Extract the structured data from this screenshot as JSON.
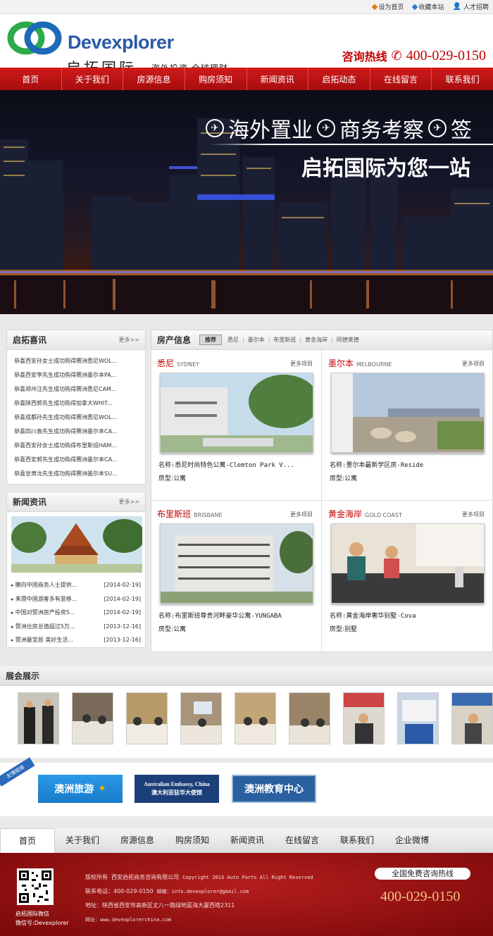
{
  "topbar": {
    "set_home": "设为首页",
    "bookmark": "收藏本站",
    "jobs": "人才招聘"
  },
  "header": {
    "brand_en": "Devexplorer",
    "brand_cn": "启拓国际",
    "tagline": "海外投资 全球理财",
    "hotline_label": "咨询热线",
    "hotline_number": "400-029-0150"
  },
  "nav": [
    "首页",
    "关于我们",
    "房源信息",
    "购房须知",
    "新闻资讯",
    "启拓动态",
    "在线留言",
    "联系我们"
  ],
  "banner": {
    "line1": [
      "海外置业",
      "商务考察",
      "签"
    ],
    "line2": "启拓国际为您一站"
  },
  "qituo_news": {
    "title": "启拓喜讯",
    "more": "更多>>",
    "items": [
      "恭喜西安孙女士成功购得赛洲悉尼WOL...",
      "恭喜西安李先生成功购得赛洲墨尔本PA...",
      "恭喜郑州汪先生成功购得赛洲悉尼CAM...",
      "恭喜陕西郭先生成功购得加拿大WHIT...",
      "恭喜成都孙先生成功购得赛洲悉尼WOL...",
      "恭喜四川袁先生成功购得赛洲墨尔本CA...",
      "恭喜西安孙女士成功购得布里斯班HAM...",
      "恭喜西安郭先生成功购得赛洲墨尔本CA...",
      "恭喜甘肃沈先生成功购得赛洲墨尔本SU..."
    ]
  },
  "news": {
    "title": "新闻资讯",
    "more": "更多>>",
    "items": [
      {
        "text": "瞭向中国商务人士提供...",
        "date": "[2014-02-19]"
      },
      {
        "text": "来瓒中国游客多有意移...",
        "date": "[2014-02-19]"
      },
      {
        "text": "中国对赞洲房产投资5...",
        "date": "[2014-02-19]"
      },
      {
        "text": "赞洲住房总值超过5万...",
        "date": "[2013-12-16]"
      },
      {
        "text": "赞洲最宜居 美好生活...",
        "date": "[2013-12-16]"
      }
    ]
  },
  "property": {
    "title": "房产信息",
    "recommend": "推荐",
    "tabs": [
      "悉尼",
      "墨尔本",
      "布里斯班",
      "黄金海岸",
      "阿德莱德"
    ],
    "items": [
      {
        "city": "悉尼",
        "city_en": "SYDNEY",
        "more": "更多项目",
        "name": "名称:悉尼时尚特色公寓-Clemton Park V...",
        "type": "房型:公寓"
      },
      {
        "city": "墨尔本",
        "city_en": "MELBOURNE",
        "more": "更多项目",
        "name": "名称:墨尔本最新学区房-Reside",
        "type": "房型:公寓"
      },
      {
        "city": "布里斯班",
        "city_en": "BRISBANE",
        "more": "更多项目",
        "name": "名称:布里斯班尊贵河畔豪华公寓-YUNGABA",
        "type": "房型:公寓"
      },
      {
        "city": "黄金海岸",
        "city_en": "GOLD COAST",
        "more": "更多项目",
        "name": "名称:黄金海岸奢华别墅-Cova",
        "type": "房型:别墅"
      }
    ]
  },
  "expo": {
    "title": "展会展示"
  },
  "links": {
    "ribbon": "友情链接",
    "travel": "澳洲旅游",
    "embassy_en": "Australian Embassy, China",
    "embassy_cn": "澳大利亚驻华大使馆",
    "edu": "澳洲教育中心"
  },
  "footer_nav": [
    "首页",
    "关于我们",
    "房源信息",
    "购房须知",
    "新闻资讯",
    "在线留言",
    "联系我们",
    "企业微博"
  ],
  "footer": {
    "qr_caption1": "启拓国际微信",
    "qr_caption2": "微信号:Devexplorer",
    "copyright_label": "版权所有",
    "company": "西安启拓商务咨询有限公司",
    "copyright": "Copyright 2013 Auto Parts All Right Reserved",
    "phone": "联系电话：400-029-0150",
    "email": "邮箱：info.devexplorer@gmail.com",
    "address": "地址：陕西省西安市高新区丈八一路绿地蓝海大厦西塔2311",
    "website": "网址：www.devexplorerchina.com",
    "free_hotline": "全国免费咨询热线",
    "hotline_number": "400-029-0150"
  },
  "colors": {
    "brand_red": "#c40000",
    "brand_blue": "#2a5aa8"
  }
}
